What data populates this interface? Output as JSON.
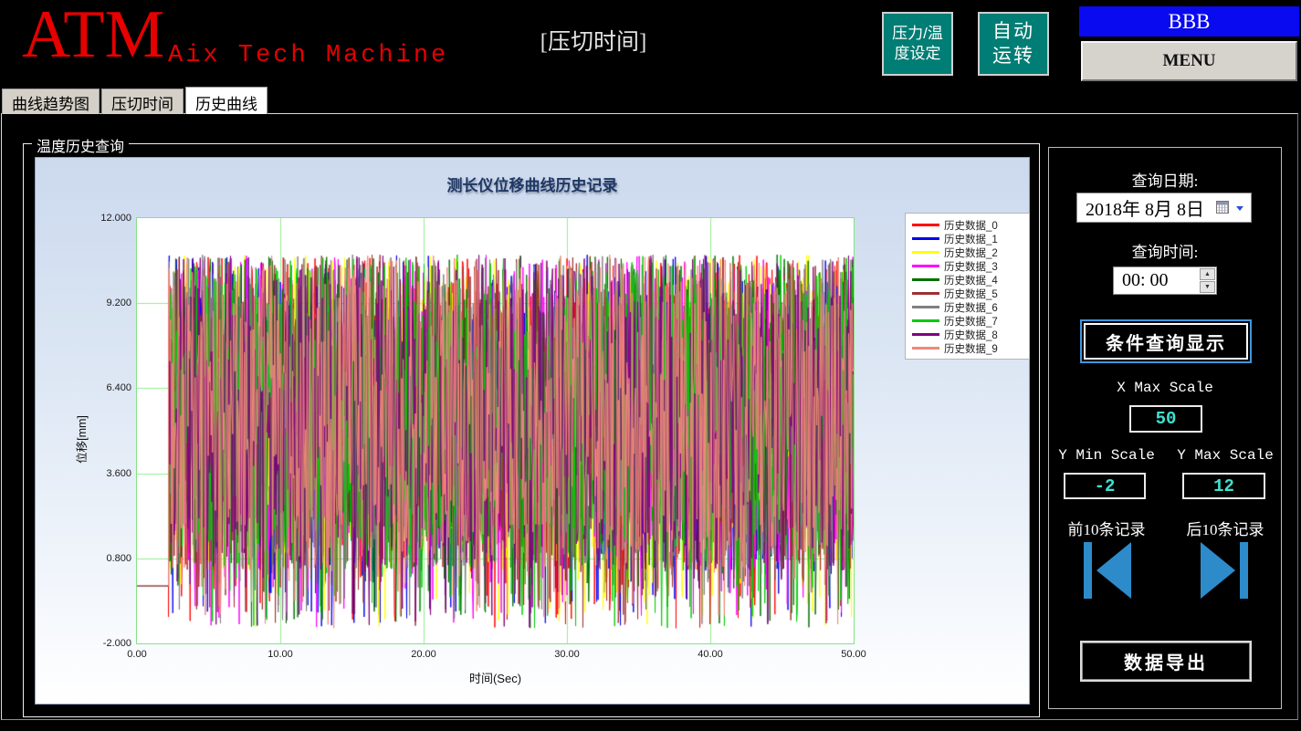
{
  "header": {
    "logo_text": "ATM",
    "logo_sub": "Aix Tech Machine",
    "logo_color": "#e60000",
    "page_title": "[压切时间]",
    "pressure_btn_line1": "压力/温",
    "pressure_btn_line2": "度设定",
    "auto_btn_line1": "自动",
    "auto_btn_line2": "运转",
    "teal_color": "#007d74",
    "banner_text": "BBB",
    "banner_color": "#0a0af0",
    "menu_label": "MENU"
  },
  "tabs": [
    {
      "label": "曲线趋势图",
      "active": false
    },
    {
      "label": "压切时间",
      "active": false
    },
    {
      "label": "历史曲线",
      "active": true
    }
  ],
  "group_title": "温度历史查询",
  "chart_data": {
    "type": "line",
    "title": "测长仪位移曲线历史记录",
    "xlabel": "时间(Sec)",
    "ylabel": "位移[mm]",
    "xlim": [
      0,
      50
    ],
    "ylim": [
      -2,
      12
    ],
    "x_ticks": [
      "0.00",
      "10.00",
      "20.00",
      "30.00",
      "40.00",
      "50.00"
    ],
    "y_ticks": [
      "12.000",
      "9.200",
      "6.400",
      "3.600",
      "0.800",
      "-2.000"
    ],
    "grid": true,
    "grid_color": "#90ee90",
    "axis_color": "#86e286",
    "plot_bg": "#ffffff",
    "legend_position": "right",
    "series": [
      {
        "name": "历史数据_0",
        "color": "#ff0000"
      },
      {
        "name": "历史数据_1",
        "color": "#0000ee"
      },
      {
        "name": "历史数据_2",
        "color": "#ffff00"
      },
      {
        "name": "历史数据_3",
        "color": "#ff00ff"
      },
      {
        "name": "历史数据_4",
        "color": "#007000"
      },
      {
        "name": "历史数据_5",
        "color": "#a03030"
      },
      {
        "name": "历史数据_6",
        "color": "#808080"
      },
      {
        "name": "历史数据_7",
        "color": "#00cc00"
      },
      {
        "name": "历史数据_8",
        "color": "#800080"
      },
      {
        "name": "历史数据_9",
        "color": "#f08878"
      }
    ],
    "generation": {
      "description": "10 series of dense uniform random noise; flat near 0 until ~2.2s then oscillating roughly 0.4..10.8 mm with sparse dips to -1.5 mm",
      "seed_base": 1013,
      "points_per_series": 950,
      "flat_until_x": 2.2,
      "flat_value": -0.1,
      "dense_min": 0.4,
      "dense_max": 10.8,
      "dip_min": -1.5,
      "dip_probability": 0.05
    }
  },
  "sidebar": {
    "query_date_label": "查询日期:",
    "date_value": "2018年 8月 8日",
    "query_time_label": "查询时间:",
    "time_value": "00: 00",
    "spinner_up_glyph": "▲",
    "spinner_down_glyph": "▼",
    "query_button_label": "条件查询显示",
    "x_max_label": "X Max Scale",
    "x_max_value": "50",
    "y_min_label": "Y Min Scale",
    "y_min_value": "-2",
    "y_max_label": "Y Max Scale",
    "y_max_value": "12",
    "prev_label": "前10条记录",
    "next_label": "后10条记录",
    "export_button_label": "数据导出",
    "value_color": "#40e0d0",
    "accent_blue": "#2e8bc9"
  }
}
